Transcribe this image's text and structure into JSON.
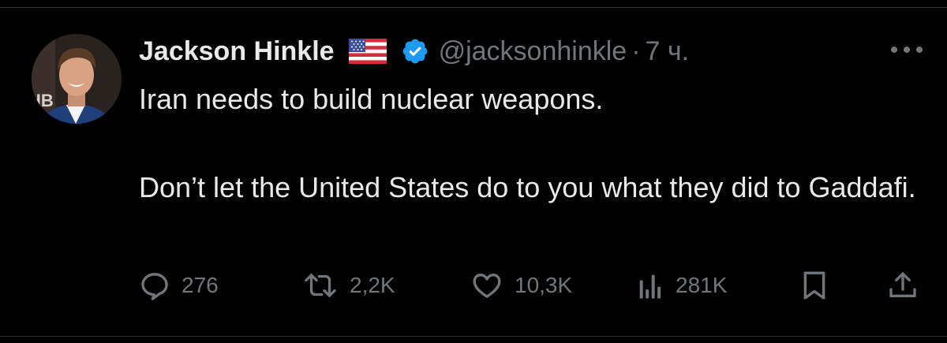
{
  "tweet": {
    "author_name": "Jackson Hinkle",
    "flag_icon": "us-flag-icon",
    "verified_icon": "verified-badge-icon",
    "verified_color": "#1d9bf0",
    "handle": "@jacksonhinkle",
    "separator": "·",
    "time": "7 ч.",
    "avatar_logo_text": "HB",
    "text_line1": "Iran needs to build nuclear weapons.",
    "text_line2": "Don’t let the United States do to you what they did to Gaddafi."
  },
  "actions": {
    "reply_count": "276",
    "retweet_count": "2,2K",
    "like_count": "10,3K",
    "views_count": "281K",
    "icons": [
      "reply-icon",
      "retweet-icon",
      "like-icon",
      "views-icon",
      "bookmark-icon",
      "share-icon"
    ]
  },
  "colors": {
    "background": "#000000",
    "text_primary": "#e7e9ea",
    "text_secondary": "#71767b"
  }
}
